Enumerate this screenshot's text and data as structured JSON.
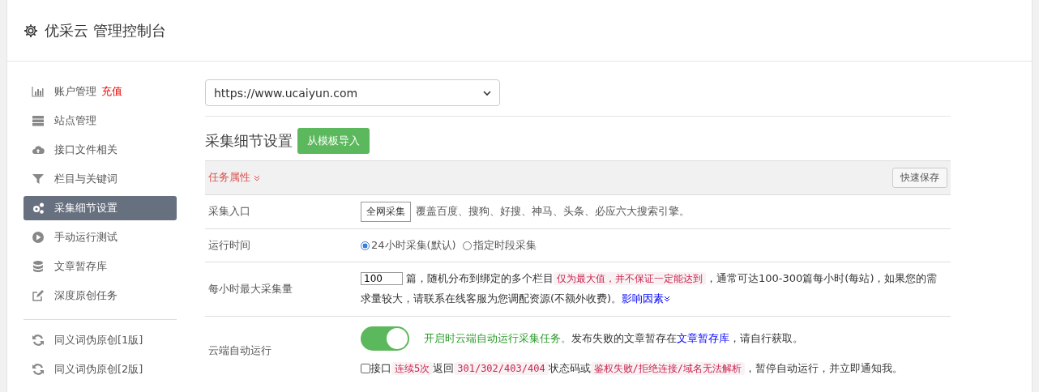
{
  "header": {
    "title": "优采云 管理控制台"
  },
  "sidebar": {
    "items": [
      {
        "kind": "item",
        "label": "账户管理",
        "badge": "充值",
        "selected": false
      },
      {
        "kind": "item",
        "label": "站点管理",
        "selected": false
      },
      {
        "kind": "item",
        "label": "接口文件相关",
        "selected": false
      },
      {
        "kind": "item",
        "label": "栏目与关键词",
        "selected": false
      },
      {
        "kind": "item",
        "label": "采集细节设置",
        "selected": true
      },
      {
        "kind": "item",
        "label": "手动运行测试",
        "selected": false
      },
      {
        "kind": "item",
        "label": "文章暂存库",
        "selected": false
      },
      {
        "kind": "item",
        "label": "深度原创任务",
        "selected": false
      },
      {
        "kind": "divider"
      },
      {
        "kind": "item",
        "label": "同义词伪原创[1版]",
        "selected": false
      },
      {
        "kind": "item",
        "label": "同义词伪原创[2版]",
        "selected": false
      }
    ]
  },
  "site_select": {
    "value": "https://www.ucaiyun.com"
  },
  "section": {
    "title": "采集细节设置",
    "import_button": "从模板导入"
  },
  "table": {
    "header": {
      "label": "任务属性",
      "save_button": "快速保存"
    },
    "rows": [
      {
        "kind": "source",
        "label": "采集入口",
        "select_value": "全网采集",
        "text": "覆盖百度、搜狗、好搜、神马、头条、必应六大搜索引擎。"
      },
      {
        "kind": "radios",
        "label": "运行时间",
        "options": [
          {
            "label": "24小时采集(默认)",
            "selected": true
          },
          {
            "label": "指定时段采集",
            "selected": false
          }
        ]
      },
      {
        "kind": "limit",
        "label": "每小时最大采集量",
        "value": "100",
        "text_before": "篇，随机分布到绑定的多个栏目",
        "code": "仅为最大值，并不保证一定能达到",
        "text_after": "，通常可达100-300篇每小时(每站)，如果您的需求量较大，请联系在线客服为您调配资源(不额外收费)。",
        "link": "影响因素"
      },
      {
        "kind": "auto",
        "label": "云端自动运行",
        "on": true,
        "note_green": "开启时云端自动运行采集任务。",
        "note": "发布失败的文章暂存在",
        "note_link": "文章暂存库",
        "note_end": "，请自行获取。",
        "checked": false,
        "check_parts": [
          "接口",
          "连续5次",
          "返回",
          "301/302/403/404",
          "状态码或",
          "鉴权失败/拒绝连接/域名无法解析",
          "，暂停自动运行，并立即通知我。"
        ]
      }
    ]
  }
}
